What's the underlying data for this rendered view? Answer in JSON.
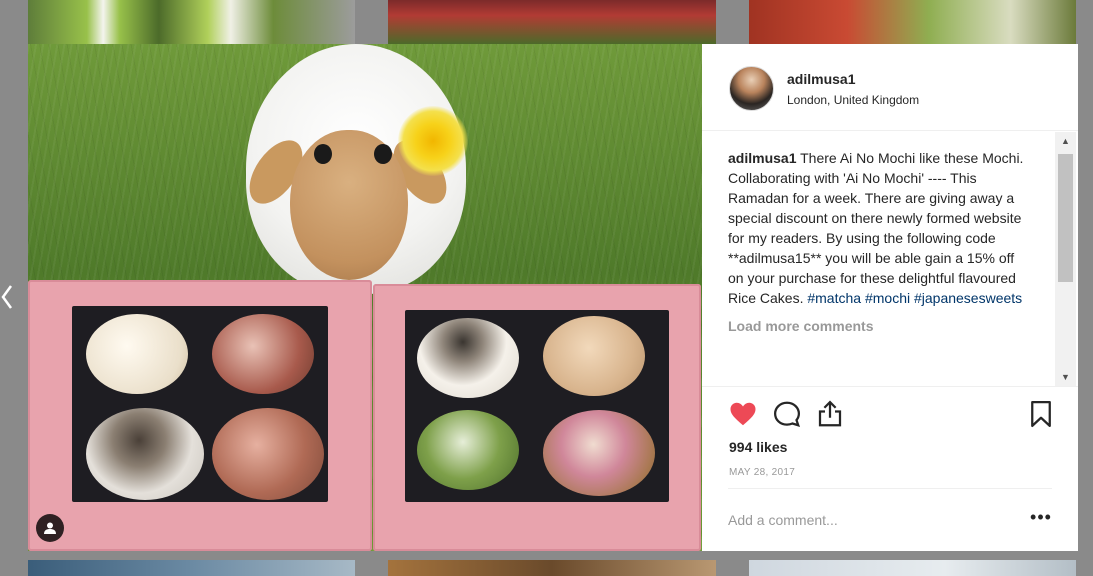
{
  "post": {
    "username": "adilmusa1",
    "location": "London, United Kingdom",
    "caption": {
      "username": "adilmusa1",
      "text": "There Ai No Mochi like these Mochi. Collaborating with 'Ai No Mochi' ---- This Ramadan for a week. There are giving away a special discount on there newly formed website for my readers. By using the following code **adilmusa15** you will be able gain a 15% off on your purchase for these delightful flavoured Rice Cakes.",
      "tags": [
        "#matcha",
        "#mochi",
        "#japanesesweets"
      ]
    },
    "load_more_label": "Load more comments",
    "likes": "994 likes",
    "date": "MAY 28, 2017",
    "comment_placeholder": "Add a comment...",
    "more_options": "•••"
  },
  "icons": {
    "prev": "chevron-left-icon",
    "heart": "heart-icon",
    "comment": "comment-icon",
    "share": "share-icon",
    "bookmark": "bookmark-icon",
    "user_tag": "user-tag-icon"
  },
  "colors": {
    "heart": "#ed4956",
    "link": "#003569",
    "muted": "#999999",
    "text": "#262626"
  }
}
